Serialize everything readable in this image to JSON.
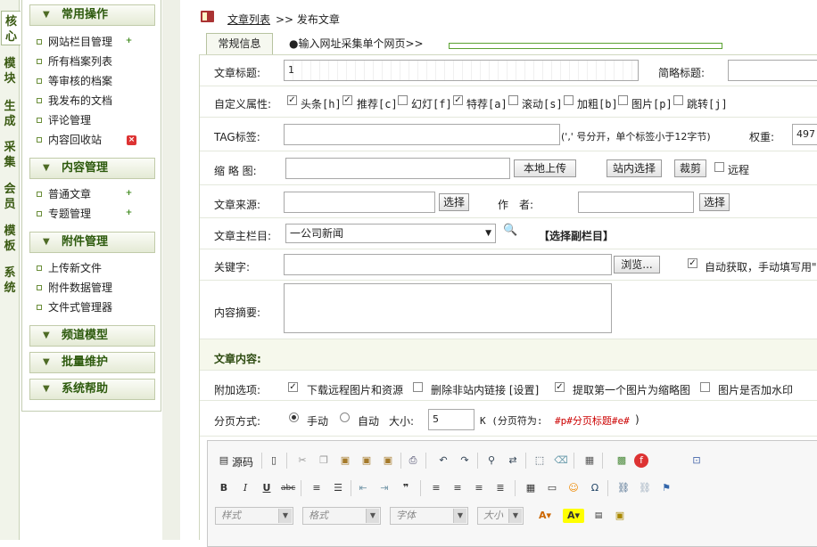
{
  "vtabs": [
    "核心",
    "模块",
    "生成",
    "采集",
    "会员",
    "模板",
    "系统"
  ],
  "sidebar": {
    "sections": [
      {
        "title": "常用操作",
        "items": [
          {
            "label": "网站栏目管理",
            "icon": "add-icon"
          },
          {
            "label": "所有档案列表"
          },
          {
            "label": "等审核的档案"
          },
          {
            "label": "我发布的文档"
          },
          {
            "label": "评论管理"
          },
          {
            "label": "内容回收站",
            "icon": "delete-icon"
          }
        ]
      },
      {
        "title": "内容管理",
        "items": [
          {
            "label": "普通文章",
            "icon": "add-icon"
          },
          {
            "label": "专题管理",
            "icon": "add-icon"
          }
        ]
      },
      {
        "title": "附件管理",
        "items": [
          {
            "label": "上传新文件"
          },
          {
            "label": "附件数据管理"
          },
          {
            "label": "文件式管理器"
          }
        ]
      },
      {
        "title": "频道模型",
        "items": []
      },
      {
        "title": "批量维护",
        "items": []
      },
      {
        "title": "系统帮助",
        "items": []
      }
    ]
  },
  "breadcrumb": {
    "link": "文章列表",
    "rest": ">> 发布文章"
  },
  "tabs": {
    "general": "常规信息",
    "collect": "●输入网址采集单个网页>>"
  },
  "form": {
    "title_label": "文章标题:",
    "title_value": "1",
    "short_title_label": "简略标题:",
    "attr_label": "自定义属性:",
    "attrs": [
      {
        "label": "头条[h]",
        "checked": true
      },
      {
        "label": "推荐[c]",
        "checked": true
      },
      {
        "label": "幻灯[f]",
        "checked": false
      },
      {
        "label": "特荐[a]",
        "checked": true
      },
      {
        "label": "滚动[s]",
        "checked": false
      },
      {
        "label": "加粗[b]",
        "checked": false
      },
      {
        "label": "图片[p]",
        "checked": false
      },
      {
        "label": "跳转[j]",
        "checked": false
      }
    ],
    "tag_label": "TAG标签:",
    "tag_note": "(',' 号分开，单个标签小于12字节)",
    "weight_label": "权重:",
    "weight_value": "497",
    "thumb_label": "缩 略 图:",
    "upload_btn": "本地上传",
    "site_select_btn": "站内选择",
    "crop_btn": "裁剪",
    "remote_label": "远程",
    "source_label": "文章来源:",
    "select_btn": "选择",
    "author_label": "作　者:",
    "author_select_btn": "选择",
    "column_label": "文章主栏目:",
    "column_value": "一公司新闻",
    "sub_column": "【选择副栏目】",
    "keywords_label": "关键字:",
    "browse_btn": "浏览...",
    "auto_label": "自动获取，手动填写用\",\"",
    "summary_label": "内容摘要:",
    "content_label": "文章内容:",
    "extra_label": "附加选项:",
    "extras": [
      {
        "label": "下载远程图片和资源",
        "checked": true
      },
      {
        "label": "删除非站内链接 [设置]",
        "checked": false
      },
      {
        "label": "提取第一个图片为缩略图",
        "checked": true
      },
      {
        "label": "图片是否加水印",
        "checked": false
      }
    ],
    "paging_label": "分页方式:",
    "manual": "手动",
    "auto": "自动",
    "size_label": "大小:",
    "size_value": "5",
    "size_unit": "K (分页符为:",
    "page_marker": "#p#分页标题#e#",
    "page_close": ")"
  },
  "editor": {
    "source": "源码",
    "combos": [
      "样式",
      "格式",
      "字体",
      "大小"
    ]
  }
}
